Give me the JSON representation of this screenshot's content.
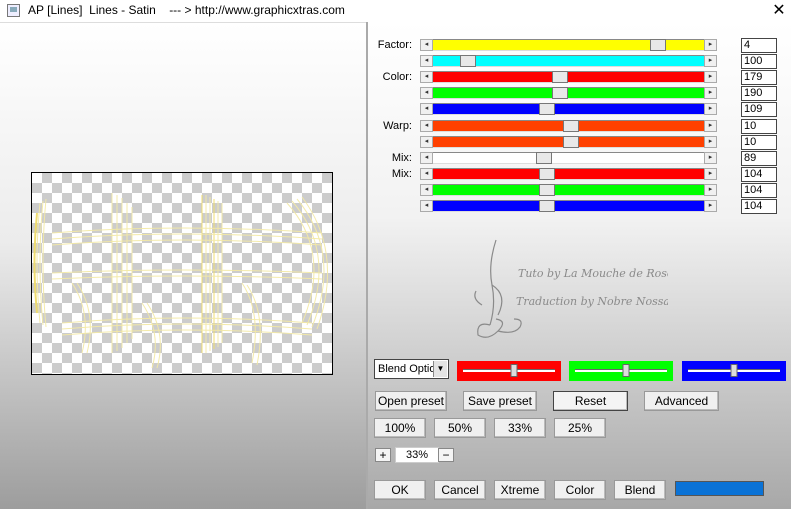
{
  "window": {
    "title": "AP [Lines]  Lines - Satin    --- > http://www.graphicxtras.com",
    "close_glyph": "✕"
  },
  "params": [
    {
      "label": "Factor:",
      "value": "4",
      "fraction": 0.83,
      "color": "#ffff00"
    },
    {
      "label": "",
      "value": "100",
      "fraction": 0.13,
      "color": "#00ffff"
    },
    {
      "label": "Color:",
      "value": "179",
      "fraction": 0.47,
      "color": "#ff0000"
    },
    {
      "label": "",
      "value": "190",
      "fraction": 0.47,
      "color": "#00ff00"
    },
    {
      "label": "",
      "value": "109",
      "fraction": 0.42,
      "color": "#0000ff"
    },
    {
      "label": "Warp:",
      "value": "10",
      "fraction": 0.51,
      "color": "#ff4000"
    },
    {
      "label": "",
      "value": "10",
      "fraction": 0.51,
      "color": "#ff4000"
    },
    {
      "label": "Mix:",
      "value": "89",
      "fraction": 0.41,
      "color": "#ffffff"
    },
    {
      "label": "Mix:",
      "value": "104",
      "fraction": 0.42,
      "color": "#ff0000"
    },
    {
      "label": "",
      "value": "104",
      "fraction": 0.42,
      "color": "#00ff00"
    },
    {
      "label": "",
      "value": "104",
      "fraction": 0.42,
      "color": "#0000ff"
    }
  ],
  "watermark": {
    "line1": "Tuto by La Mouche de Rose",
    "line2": "Traduction by Nobre Nossas"
  },
  "blend": {
    "select_value": "Blend Options",
    "dropdown_glyph": "▼",
    "color_sliders": [
      {
        "color": "#ff0000",
        "fraction": 0.55
      },
      {
        "color": "#00ff00",
        "fraction": 0.55
      },
      {
        "color": "#0000ff",
        "fraction": 0.5
      }
    ]
  },
  "buttons": {
    "open_preset": "Open preset",
    "save_preset": "Save preset",
    "reset": "Reset",
    "advanced": "Advanced",
    "zoom_100": "100%",
    "zoom_50": "50%",
    "zoom_33": "33%",
    "zoom_25": "25%",
    "ok": "OK",
    "cancel": "Cancel",
    "xtreme": "Xtreme",
    "color": "Color",
    "blend": "Blend"
  },
  "zoom": {
    "plus": "+",
    "minus": "−",
    "value": "33%"
  },
  "blend_color_swatch": "#0a72d6",
  "arrow_left_glyph": "◂",
  "arrow_right_glyph": "▸"
}
